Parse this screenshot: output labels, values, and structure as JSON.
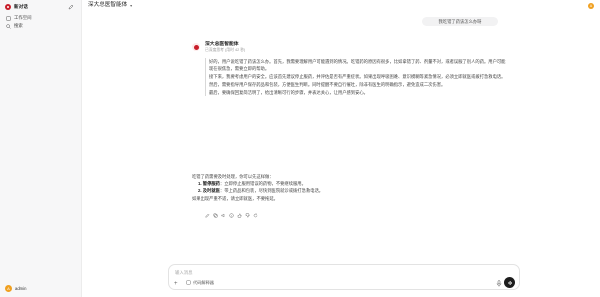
{
  "sidebar": {
    "brand": "新对话",
    "items": [
      {
        "label": "工作空间",
        "icon": "workspace-icon"
      },
      {
        "label": "搜索",
        "icon": "search-icon"
      }
    ],
    "user_initial": "A",
    "user_name": "admin"
  },
  "header": {
    "title": "深大总医智能体",
    "avatar_initial": "A"
  },
  "user_message": "我吃错了药该怎么办呀",
  "assistant": {
    "name": "深大总医智能体",
    "meta": "已深度思考 (用时 42 秒)",
    "quote_paragraphs": [
      "好的，用户说吃错了药该怎么办。首先，我需要理解用户可能遇到的情况。吃错药的原因有很多，比如拿错了药、剂量不对，或者误服了别人的药。用户可能现在很焦急，需要立即的帮助。",
      "接下来，我要考虑用户的安全。应该首先建议停止服药，并评估是否有严重症状。如果出现呼吸困难、意识模糊等紧急情况，必须立即就医或拨打急救电话。",
      "然后，需要指导用户保存药品和包装，方便医生判断。同时提醒不要自行催吐，除非有医生的明确指示，避免造成二次伤害。",
      "最后，要确保回复简洁明了，给出清晰可行的步骤，并表达关心，让用户感到安心。"
    ],
    "intro": "吃错了药需要及时处理，你可以先这样做：",
    "list": [
      {
        "title": "1. 暂停服药",
        "text": "：立即停止服用错误的药物，不要继续服用。"
      },
      {
        "title": "2. 及时就医",
        "text": "：带上药品和包装，尽快到医院就诊或拨打急救电话。"
      }
    ],
    "closing": "如果出现严重不适，请立即就医，不要拖延。"
  },
  "input": {
    "placeholder": "输入消息",
    "chip_label": "代码解释器"
  },
  "colors": {
    "brand": "#c81e2a",
    "avatar": "#f0a020",
    "send": "#1c1c1c"
  }
}
